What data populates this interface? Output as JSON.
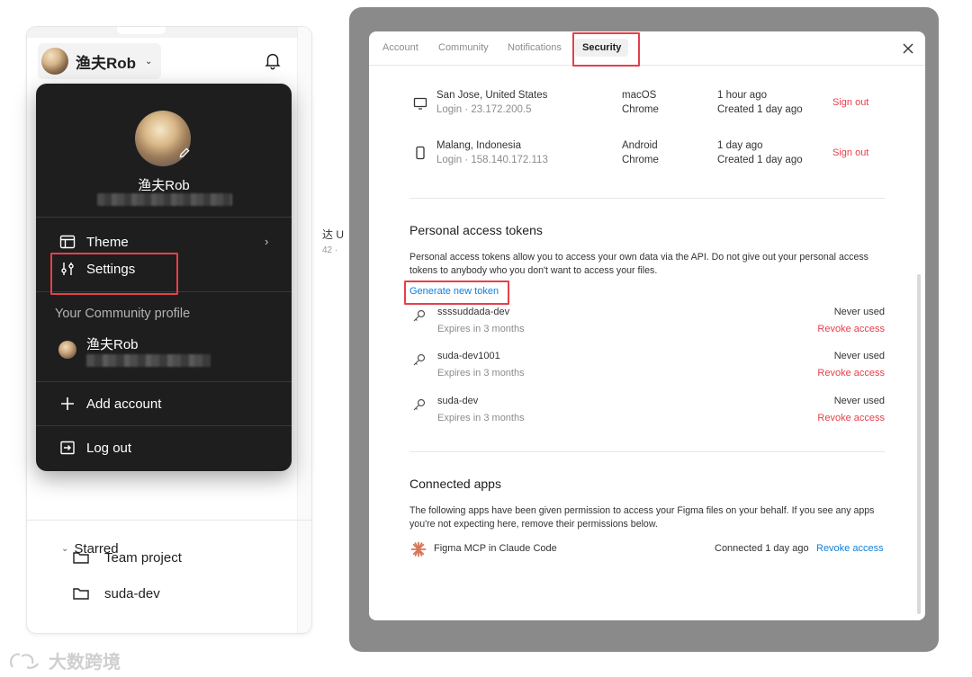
{
  "left": {
    "account_name": "渔夫Rob",
    "menu": {
      "user_name": "渔夫Rob",
      "theme_label": "Theme",
      "settings_label": "Settings",
      "community_section": "Your Community profile",
      "community_name": "渔夫Rob",
      "add_account_label": "Add account",
      "logout_label": "Log out"
    },
    "partial_text": "达 U",
    "partial_sub": "42 ·",
    "starred": {
      "label": "Starred",
      "items": [
        "Team project",
        "suda-dev"
      ]
    }
  },
  "modal": {
    "tabs": [
      "Account",
      "Community",
      "Notifications",
      "Security"
    ],
    "active_tab": "Security",
    "sessions": [
      {
        "location": "San Jose, United States",
        "login": "Login · 23.172.200.5",
        "os": "macOS",
        "browser": "Chrome",
        "last_active": "1 hour ago",
        "created": "Created 1 day ago",
        "action": "Sign out",
        "device_icon": "monitor-icon"
      },
      {
        "location": "Malang, Indonesia",
        "login": "Login · 158.140.172.113",
        "os": "Android",
        "browser": "Chrome",
        "last_active": "1 day ago",
        "created": "Created 1 day ago",
        "action": "Sign out",
        "device_icon": "phone-icon"
      }
    ],
    "pat": {
      "title": "Personal access tokens",
      "description": "Personal access tokens allow you to access your own data via the API. Do not give out your personal access tokens to anybody who you don't want to access your files.",
      "generate_label": "Generate new token",
      "tokens": [
        {
          "name": "ssssuddada-dev",
          "expires": "Expires in 3 months",
          "usage": "Never used",
          "action": "Revoke access"
        },
        {
          "name": "suda-dev1001",
          "expires": "Expires in 3 months",
          "usage": "Never used",
          "action": "Revoke access"
        },
        {
          "name": "suda-dev",
          "expires": "Expires in 3 months",
          "usage": "Never used",
          "action": "Revoke access"
        }
      ]
    },
    "connected_apps": {
      "title": "Connected apps",
      "description": "The following apps have been given permission to access your Figma files on your behalf. If you see any apps you're not expecting here, remove their permissions below.",
      "apps": [
        {
          "name": "Figma MCP in Claude Code",
          "status": "Connected 1 day ago",
          "action": "Revoke access"
        }
      ]
    }
  },
  "watermark": "大数跨境",
  "colors": {
    "highlight": "#e5404a",
    "link": "#0d7fdc",
    "danger": "#e5404a",
    "menu_bg": "#1e1e1e"
  }
}
